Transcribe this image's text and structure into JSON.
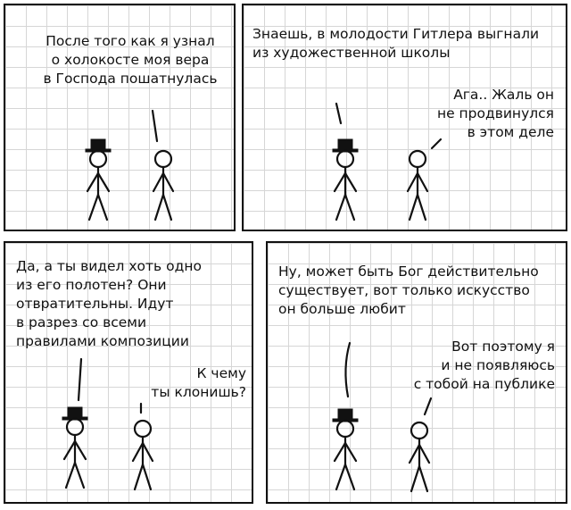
{
  "panels": [
    {
      "left_text": "",
      "right_text": "",
      "top_text": "После того как я узнал\nо холокосте моя вера\nв Господа пошатнулась"
    },
    {
      "top_text": "Знаешь, в молодости Гитлера выгнали\nиз художественной школы",
      "reply_text": "Ага.. Жаль он\nне продвинулся\nв этом деле"
    },
    {
      "top_text": "Да, а ты видел хоть одно\nиз его полотен? Они\nотвратительны. Идут\nв разрез со всеми\nправилами композиции",
      "reply_text": "К чему\nты клонишь?"
    },
    {
      "top_text": "Ну, может быть Бог действительно\nсуществует, вот только искусство\nон больше любит",
      "reply_text": "Вот поэтому я\nи не появляюсь\nс тобой на публике"
    }
  ]
}
